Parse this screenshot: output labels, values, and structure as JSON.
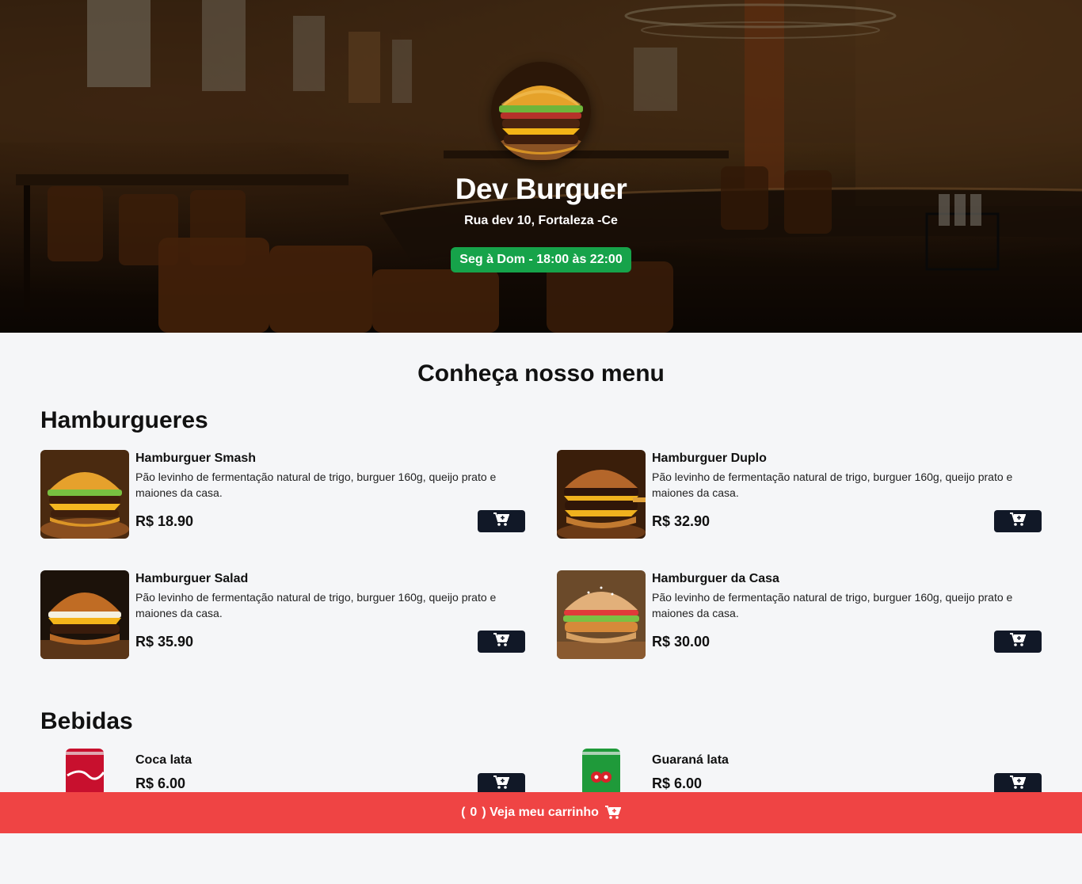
{
  "header": {
    "title": "Dev Burguer",
    "address": "Rua dev 10, Fortaleza -Ce",
    "hours": "Seg à Dom - 18:00 às 22:00"
  },
  "menu": {
    "heading": "Conheça nosso menu",
    "sections": [
      {
        "title": "Hamburgueres",
        "items": [
          {
            "name": "Hamburguer Smash",
            "description": "Pão levinho de fermentação natural de trigo, burguer 160g, queijo prato e maiones da casa.",
            "price": "R$ 18.90"
          },
          {
            "name": "Hamburguer Duplo",
            "description": "Pão levinho de fermentação natural de trigo, burguer 160g, queijo prato e maiones da casa.",
            "price": "R$ 32.90"
          },
          {
            "name": "Hamburguer Salad",
            "description": "Pão levinho de fermentação natural de trigo, burguer 160g, queijo prato e maiones da casa.",
            "price": "R$ 35.90"
          },
          {
            "name": "Hamburguer da Casa",
            "description": "Pão levinho de fermentação natural de trigo, burguer 160g, queijo prato e maiones da casa.",
            "price": "R$ 30.00"
          }
        ]
      },
      {
        "title": "Bebidas",
        "items": [
          {
            "name": "Coca lata",
            "price": "R$ 6.00"
          },
          {
            "name": "Guaraná lata",
            "price": "R$ 6.00"
          }
        ]
      }
    ]
  },
  "cart": {
    "open_paren": "(",
    "count": "0",
    "label": ") Veja meu carrinho"
  },
  "colors": {
    "hours_badge": "#16a34a",
    "add_button": "#111827",
    "cart_bar": "#ef4444",
    "page_bg": "#f5f6f8"
  },
  "icons": {
    "add_to_cart": "cart-plus-icon",
    "cart": "cart-icon"
  }
}
